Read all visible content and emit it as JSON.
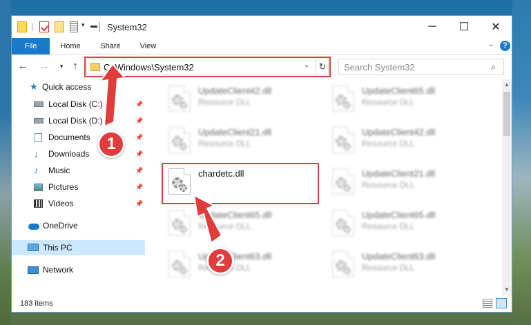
{
  "titlebar": {
    "title": "System32",
    "minimize_glyph": "─",
    "maximize_glyph": "☐",
    "close_glyph": "✕"
  },
  "ribbon": {
    "tabs": [
      {
        "label": "File"
      },
      {
        "label": "Home"
      },
      {
        "label": "Share"
      },
      {
        "label": "View"
      }
    ],
    "help_glyph": "?"
  },
  "nav": {
    "back_glyph": "←",
    "forward_glyph": "→",
    "recent_glyph": "▾",
    "up_glyph": "↑"
  },
  "address": {
    "path": "C:\\Windows\\System32",
    "dropdown_glyph": "⌄",
    "refresh_glyph": "↻"
  },
  "search": {
    "placeholder": "Search System32",
    "icon_glyph": "⌕"
  },
  "sidebar": {
    "items": [
      {
        "label": "Quick access",
        "icon": "star-icon"
      },
      {
        "label": "Local Disk (C:)",
        "icon": "drive-icon"
      },
      {
        "label": "Local Disk (D:)",
        "icon": "drive-icon"
      },
      {
        "label": "Documents",
        "icon": "documents-icon"
      },
      {
        "label": "Downloads",
        "icon": "download-icon"
      },
      {
        "label": "Music",
        "icon": "music-icon"
      },
      {
        "label": "Pictures",
        "icon": "pictures-icon"
      },
      {
        "label": "Videos",
        "icon": "videos-icon"
      },
      {
        "label": "OneDrive",
        "icon": "cloud-icon"
      },
      {
        "label": "This PC",
        "icon": "computer-icon"
      },
      {
        "label": "Network",
        "icon": "network-icon"
      }
    ],
    "pin_glyph": "📌"
  },
  "files": {
    "left": [
      {
        "name": "UpdateClient42.dll",
        "type": "Resource DLL"
      },
      {
        "name": "UpdateClient21.dll",
        "type": "Resource DLL"
      },
      {
        "name": "chardetc.dll",
        "type": ""
      },
      {
        "name": "UpdateClient65.dll",
        "type": "Resource DLL"
      },
      {
        "name": "UpdateClient63.dll",
        "type": "Resource DLL"
      }
    ],
    "right": [
      {
        "name": "UpdateClient65.dll",
        "type": "Resource DLL"
      },
      {
        "name": "UpdateClient42.dll",
        "type": "Resource DLL"
      },
      {
        "name": "UpdateClient21.dll",
        "type": "Resource DLL"
      },
      {
        "name": "UpdateClient65.dll",
        "type": "Resource DLL"
      },
      {
        "name": "UpdateClient63.dll",
        "type": "Resource DLL"
      }
    ]
  },
  "status": {
    "item_count": "183 items"
  },
  "callouts": {
    "step1": "1",
    "step2": "2"
  },
  "colors": {
    "accent": "#1979ca",
    "highlight": "#e03c3c",
    "selection": "#cce8ff"
  }
}
